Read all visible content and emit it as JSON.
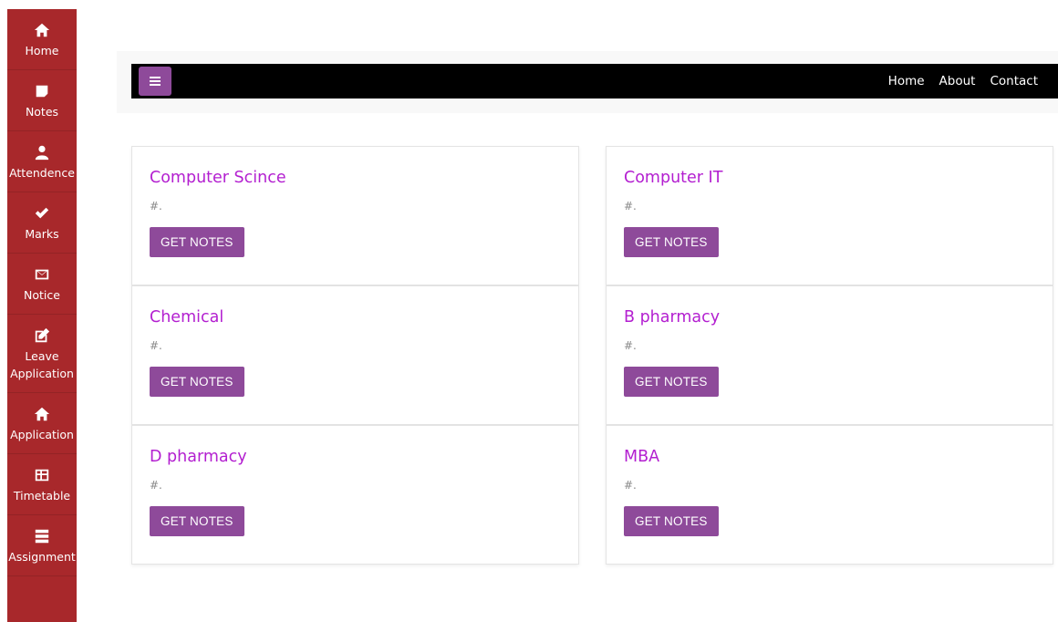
{
  "sidebar": {
    "items": [
      {
        "label": "Home",
        "icon": "home-icon"
      },
      {
        "label": "Notes",
        "icon": "note-icon"
      },
      {
        "label": "Attendence",
        "icon": "user-icon"
      },
      {
        "label": "Marks",
        "icon": "check-icon"
      },
      {
        "label": "Notice",
        "icon": "envelope-icon"
      },
      {
        "label": "Leave",
        "label2": "Application",
        "icon": "edit-icon"
      },
      {
        "label": "Application",
        "icon": "home-icon"
      },
      {
        "label": "Timetable",
        "icon": "table-icon"
      },
      {
        "label": "Assignment",
        "icon": "server-icon"
      }
    ],
    "color": "#a8282b"
  },
  "navbar": {
    "links": [
      "Home",
      "About",
      "Contact"
    ],
    "toggle_color": "#8e4a9a"
  },
  "cards": [
    {
      "title": "Computer Scince",
      "text": "#.",
      "button": "GET NOTES"
    },
    {
      "title": "Computer IT",
      "text": "#.",
      "button": "GET NOTES"
    },
    {
      "title": "Chemical",
      "text": "#.",
      "button": "GET NOTES"
    },
    {
      "title": "B pharmacy",
      "text": "#.",
      "button": "GET NOTES"
    },
    {
      "title": "D pharmacy",
      "text": "#.",
      "button": "GET NOTES"
    },
    {
      "title": "MBA",
      "text": "#.",
      "button": "GET NOTES"
    }
  ],
  "colors": {
    "title": "#b31fd0",
    "button": "#8e4a9a"
  }
}
